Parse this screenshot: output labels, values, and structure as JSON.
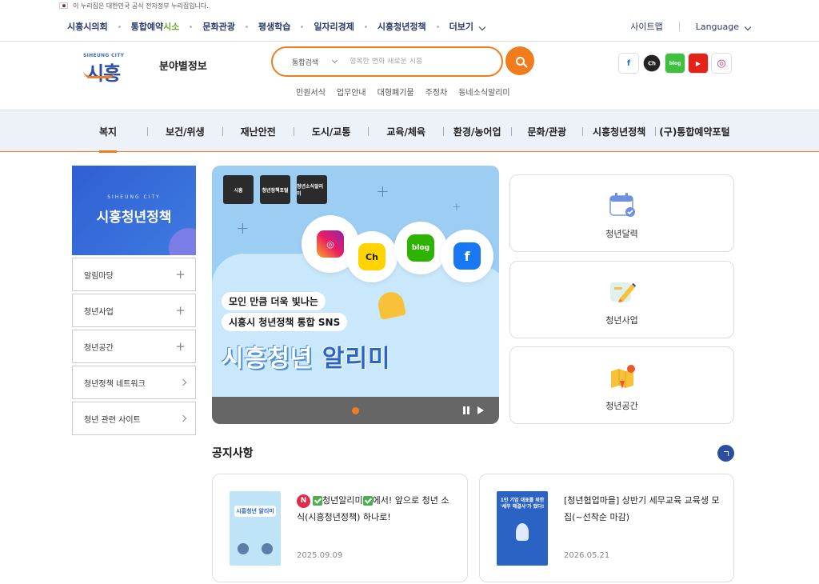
{
  "gov_banner": "이 누리집은 대한민국 공식 전자정부 누리집입니다.",
  "topnav": {
    "links": [
      "시흥시의회",
      "통합예약",
      "시소",
      "문화관광",
      "평생학습",
      "일자리경제",
      "시흥청년정책",
      "더보기"
    ],
    "sitemap": "사이트맵",
    "language": "Language"
  },
  "header": {
    "logo_sub": "SIHEUNG CITY",
    "logo_main": "시흥",
    "category_title": "분야별정보",
    "search_select": "통합검색",
    "search_placeholder": "행복한 변화 새로운 시흥",
    "quick_links": [
      "민원서식",
      "업무안내",
      "대형폐기물",
      "주정차",
      "동네소식알리미"
    ],
    "social": [
      "f",
      "Ch",
      "blog",
      "▶",
      "◎"
    ]
  },
  "mainnav": [
    "복지",
    "보건/위생",
    "재난안전",
    "도시/교통",
    "교육/체육",
    "환경/농어업",
    "문화/관광",
    "시흥청년정책",
    "(구)통합예약포털"
  ],
  "sidebar": {
    "banner_en": "SIHEUNG CITY",
    "banner_ko": "시흥청년정책",
    "menu": [
      {
        "label": "알림마당",
        "type": "plus"
      },
      {
        "label": "청년사업",
        "type": "plus"
      },
      {
        "label": "청년공간",
        "type": "plus"
      },
      {
        "label": "청년정책 네트워크",
        "type": "arrow"
      },
      {
        "label": "청년 관련 사이트",
        "type": "arrow"
      }
    ]
  },
  "slider": {
    "folders": [
      "시흥",
      "청년정책포털",
      "청년소식알리미"
    ],
    "slogan1": "모인 만큼 더욱 빛나는",
    "slogan2": "시흥시 청년정책 통합 SNS",
    "headline_a": "시흥청년",
    "headline_b": "알리미",
    "sns": [
      "◎",
      "Ch",
      "blog",
      "f"
    ]
  },
  "quick_cards": [
    "청년달력",
    "청년사업",
    "청년공간"
  ],
  "notice": {
    "title": "공지사항",
    "items": [
      {
        "badge": "N",
        "text_a": "청년알리미",
        "text_b": "에서! 앞으로 청년 소식(시흥청년정책) 하나로!",
        "date": "2025.09.09",
        "thumb_label": "시흥청년 알리미"
      },
      {
        "text": "[청년협업마을] 상반기 세무교육 교육생 모집(~선착순 마감)",
        "date": "2026.05.21",
        "thumb_label": "1인 기업 대표를 위한 '세무 해결사'가 떴다!"
      }
    ]
  }
}
